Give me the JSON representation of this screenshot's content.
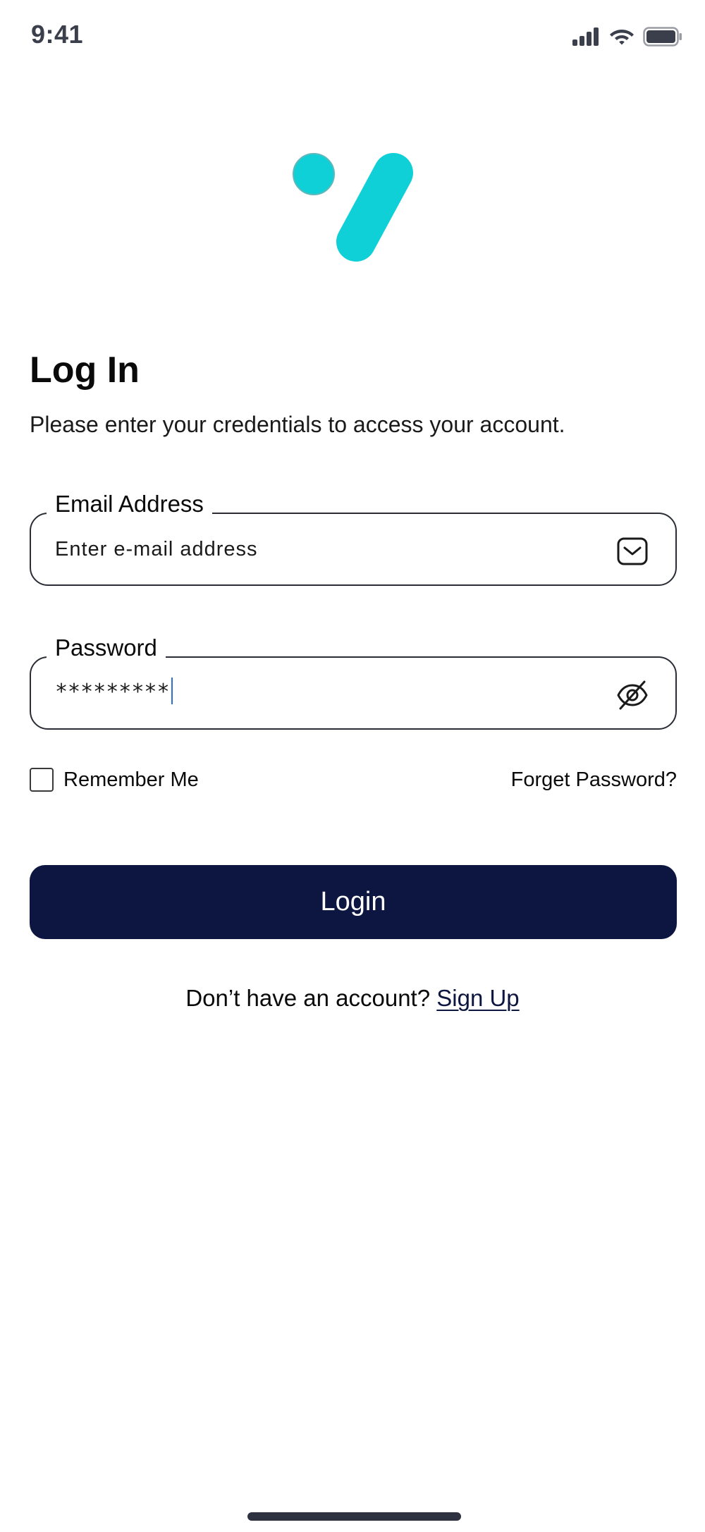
{
  "status_bar": {
    "time": "9:41"
  },
  "icons": {
    "signal": "cellular-signal-icon",
    "wifi": "wifi-icon",
    "battery": "battery-icon",
    "email": "envelope-icon",
    "password_toggle": "eye-off-icon"
  },
  "header": {
    "title": "Log In",
    "subtitle": "Please enter your credentials to access your account."
  },
  "email_field": {
    "label": "Email Address",
    "placeholder": "Enter e-mail address"
  },
  "password_field": {
    "label": "Password",
    "value": "*********"
  },
  "options": {
    "remember_label": "Remember Me",
    "remember_checked": false,
    "forgot_label": "Forget Password?"
  },
  "login_button": {
    "label": "Login"
  },
  "signup": {
    "prompt": "Don’t have an account? ",
    "link_label": "Sign Up"
  },
  "colors": {
    "brand_accent": "#0fd0d6",
    "primary_button": "#0d1640",
    "field_border": "#2a2d35",
    "caret": "#2b6fd1"
  }
}
